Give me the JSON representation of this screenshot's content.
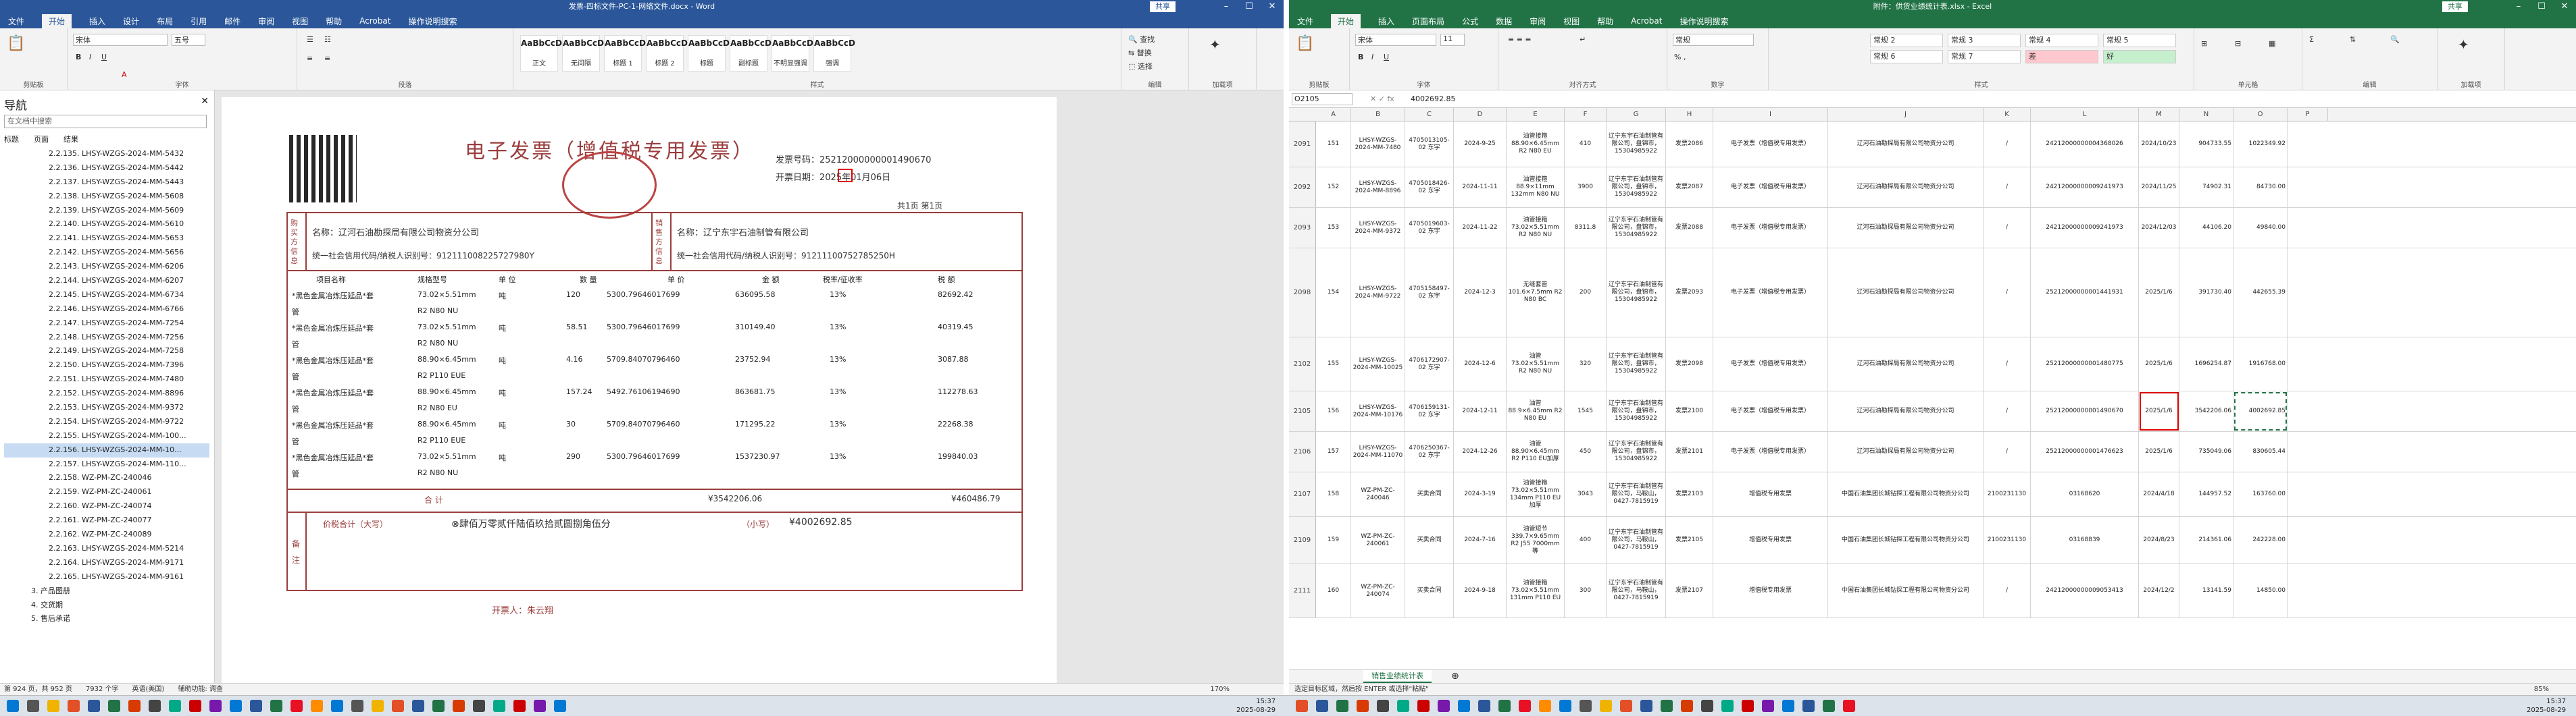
{
  "word": {
    "title": "发票-四标文件-PC-1-网络文件.docx - Word",
    "share_label": "共享",
    "menu": [
      "文件",
      "开始",
      "插入",
      "设计",
      "布局",
      "引用",
      "邮件",
      "审阅",
      "视图",
      "帮助",
      "Acrobat",
      "操作说明搜索"
    ],
    "active_menu": "开始",
    "font_name": "宋体",
    "font_size": "五号",
    "styles": [
      "正文",
      "无间隔",
      "标题 1",
      "标题 2",
      "标题",
      "副标题",
      "不明显强调",
      "强调"
    ],
    "ribbon_groups": [
      "剪贴板",
      "字体",
      "段落",
      "样式",
      "编辑",
      "加载项"
    ],
    "nav": {
      "header": "导航",
      "search_placeholder": "在文档中搜索",
      "tabs": [
        "标题",
        "页面",
        "结果"
      ],
      "items": [
        "2.2.135. LHSY-WZGS-2024-MM-5432",
        "2.2.136. LHSY-WZGS-2024-MM-5442",
        "2.2.137. LHSY-WZGS-2024-MM-5443",
        "2.2.138. LHSY-WZGS-2024-MM-5608",
        "2.2.139. LHSY-WZGS-2024-MM-5609",
        "2.2.140. LHSY-WZGS-2024-MM-5610",
        "2.2.141. LHSY-WZGS-2024-MM-5653",
        "2.2.142. LHSY-WZGS-2024-MM-5656",
        "2.2.143. LHSY-WZGS-2024-MM-6206",
        "2.2.144. LHSY-WZGS-2024-MM-6207",
        "2.2.145. LHSY-WZGS-2024-MM-6734",
        "2.2.146. LHSY-WZGS-2024-MM-6766",
        "2.2.147. LHSY-WZGS-2024-MM-7254",
        "2.2.148. LHSY-WZGS-2024-MM-7256",
        "2.2.149. LHSY-WZGS-2024-MM-7258",
        "2.2.150. LHSY-WZGS-2024-MM-7396",
        "2.2.151. LHSY-WZGS-2024-MM-7480",
        "2.2.152. LHSY-WZGS-2024-MM-8896",
        "2.2.153. LHSY-WZGS-2024-MM-9372",
        "2.2.154. LHSY-WZGS-2024-MM-9722",
        "2.2.155. LHSY-WZGS-2024-MM-100...",
        "2.2.156. LHSY-WZGS-2024-MM-10...",
        "2.2.157. LHSY-WZGS-2024-MM-110...",
        "2.2.158. WZ-PM-ZC-240046",
        "2.2.159. WZ-PM-ZC-240061",
        "2.2.160. WZ-PM-ZC-240074",
        "2.2.161. WZ-PM-ZC-240077",
        "2.2.162. WZ-PM-ZC-240089",
        "2.2.163. LHSY-WZGS-2024-MM-5214",
        "2.2.164. LHSY-WZGS-2024-MM-9171",
        "2.2.165. LHSY-WZGS-2024-MM-9161",
        "3. 产品图册",
        "4. 交货期",
        "5. 售后承诺"
      ],
      "selected_index": 21
    },
    "invoice": {
      "title": "电子发票（增值税专用发票）",
      "invoice_no_label": "发票号码：",
      "invoice_no": "25212000000001490670",
      "date_label": "开票日期：",
      "date": "2025年01月06日",
      "page": "共1页 第1页",
      "buyer_name": "名称：辽河石油勘探局有限公司物资分公司",
      "buyer_tax": "统一社会信用代码/纳税人识别号：912111008225727980Y",
      "seller_name": "名称：辽宁东宇石油制管有限公司",
      "seller_tax": "统一社会信用代码/纳税人识别号：91211100752785250H",
      "buyer_side": "购买方信息",
      "seller_side": "销售方信息",
      "col_headers": [
        "项目名称",
        "规格型号",
        "单 位",
        "数 量",
        "单 价",
        "金 额",
        "税率/征收率",
        "税 额"
      ],
      "items": [
        {
          "name": "*黑色金属冶炼压延品*套",
          "spec": "73.02×5.51mm",
          "unit": "吨",
          "qty": "120",
          "price": "5300.79646017699",
          "amount": "636095.58",
          "rate": "13%",
          "tax": "82692.42"
        },
        {
          "name": "管",
          "spec": "R2 N80 NU",
          "unit": "",
          "qty": "",
          "price": "",
          "amount": "",
          "rate": "",
          "tax": ""
        },
        {
          "name": "*黑色金属冶炼压延品*套",
          "spec": "73.02×5.51mm",
          "unit": "吨",
          "qty": "58.51",
          "price": "5300.79646017699",
          "amount": "310149.40",
          "rate": "13%",
          "tax": "40319.45"
        },
        {
          "name": "管",
          "spec": "R2 N80 NU",
          "unit": "",
          "qty": "",
          "price": "",
          "amount": "",
          "rate": "",
          "tax": ""
        },
        {
          "name": "*黑色金属冶炼压延品*套",
          "spec": "88.90×6.45mm",
          "unit": "吨",
          "qty": "4.16",
          "price": "5709.84070796460",
          "amount": "23752.94",
          "rate": "13%",
          "tax": "3087.88"
        },
        {
          "name": "管",
          "spec": "R2 P110 EUE",
          "unit": "",
          "qty": "",
          "price": "",
          "amount": "",
          "rate": "",
          "tax": ""
        },
        {
          "name": "*黑色金属冶炼压延品*套",
          "spec": "88.90×6.45mm",
          "unit": "吨",
          "qty": "157.24",
          "price": "5492.76106194690",
          "amount": "863681.75",
          "rate": "13%",
          "tax": "112278.63"
        },
        {
          "name": "管",
          "spec": "R2 N80 EU",
          "unit": "",
          "qty": "",
          "price": "",
          "amount": "",
          "rate": "",
          "tax": ""
        },
        {
          "name": "*黑色金属冶炼压延品*套",
          "spec": "88.90×6.45mm",
          "unit": "吨",
          "qty": "30",
          "price": "5709.84070796460",
          "amount": "171295.22",
          "rate": "13%",
          "tax": "22268.38"
        },
        {
          "name": "管",
          "spec": "R2 P110 EUE",
          "unit": "",
          "qty": "",
          "price": "",
          "amount": "",
          "rate": "",
          "tax": ""
        },
        {
          "name": "*黑色金属冶炼压延品*套",
          "spec": "73.02×5.51mm",
          "unit": "吨",
          "qty": "290",
          "price": "5300.79646017699",
          "amount": "1537230.97",
          "rate": "13%",
          "tax": "199840.03"
        },
        {
          "name": "管",
          "spec": "R2 N80 NU",
          "unit": "",
          "qty": "",
          "price": "",
          "amount": "",
          "rate": "",
          "tax": ""
        }
      ],
      "total_label": "合 计",
      "total_amount": "¥3542206.06",
      "total_tax": "¥460486.79",
      "grand_label": "价税合计（大写）",
      "grand_cn": "⊗肆佰万零贰仟陆佰玖拾贰圆捌角伍分",
      "grand_small_label": "（小写）",
      "grand_small": "¥4002692.85",
      "remark_label": "备 注",
      "issuer": "开票人：朱云翔"
    },
    "status": [
      "第 924 页，共 952 页",
      "7932 个字",
      "英语(美国)",
      "辅助功能: 调查"
    ],
    "zoom": "170%"
  },
  "excel": {
    "title": "附件：供货业绩统计表.xlsx - Excel",
    "share_label": "共享",
    "menu": [
      "文件",
      "开始",
      "插入",
      "页面布局",
      "公式",
      "数据",
      "审阅",
      "视图",
      "帮助",
      "Acrobat",
      "操作说明搜索"
    ],
    "active_menu": "开始",
    "font_name": "宋体",
    "font_size": "11",
    "number_format": "常规",
    "cell_styles": [
      "常规 2",
      "常规 3",
      "常规 4",
      "常规 5",
      "常规 6",
      "常规 7",
      "差",
      "好"
    ],
    "ribbon_groups": [
      "剪贴板",
      "字体",
      "对齐方式",
      "数字",
      "样式",
      "单元格",
      "编辑",
      "加载项"
    ],
    "name_box": "O2105",
    "formula": "4002692.85",
    "columns": [
      "A",
      "B",
      "C",
      "D",
      "E",
      "F",
      "G",
      "H",
      "I",
      "J",
      "K",
      "L",
      "M",
      "N",
      "O",
      "P"
    ],
    "rows": [
      {
        "rn": "2091",
        "no": "151",
        "proj": "LHSY-WZGS-2024-MM-7480",
        "code": "4705013105-02 东宇",
        "date": "2024-9-25",
        "spec": "油管接箍 88.90×6.45mm R2 N80 EU",
        "qty": "410",
        "seller": "辽宁东宇石油制管有限公司，盘锦市，15304985922",
        "inv": "发票2086",
        "type": "电子发票（增值税专用发票）",
        "buyer": "辽河石油勘探局有限公司物资分公司",
        "slash": "/",
        "invno": "24212000000004368026",
        "invdate": "2024/10/23",
        "amt": "904733.55",
        "total": "1022349.92"
      },
      {
        "rn": "2092",
        "no": "152",
        "proj": "LHSY-WZGS-2024-MM-8896",
        "code": "4705018426-02 东宇",
        "date": "2024-11-11",
        "spec": "油管接箍 88.9×11mm 132mm N80 NU",
        "qty": "3900",
        "seller": "辽宁东宇石油制管有限公司，盘锦市，15304985922",
        "inv": "发票2087",
        "type": "电子发票（增值税专用发票）",
        "buyer": "辽河石油勘探局有限公司物资分公司",
        "slash": "/",
        "invno": "24212000000009241973",
        "invdate": "2024/11/25",
        "amt": "74902.31",
        "total": "84730.00"
      },
      {
        "rn": "2093",
        "no": "153",
        "proj": "LHSY-WZGS-2024-MM-9372",
        "code": "4705019603-02 东宇",
        "date": "2024-11-22",
        "spec": "油管接箍 73.02×5.51mm R2 N80 NU",
        "qty": "8311.8",
        "seller": "辽宁东宇石油制管有限公司，盘锦市，15304985922",
        "inv": "发票2088",
        "type": "电子发票（增值税专用发票）",
        "buyer": "辽河石油勘探局有限公司物资分公司",
        "slash": "/",
        "invno": "24212000000009241973",
        "invdate": "2024/12/03",
        "amt": "44106.20",
        "total": "49840.00"
      },
      {
        "rn": "2098",
        "no": "154",
        "proj": "LHSY-WZGS-2024-MM-9722",
        "code": "4705158497-02 东宇",
        "date": "2024-12-3",
        "spec": "无缝套管 101.6×7.5mm R2 N80 BC",
        "qty": "200",
        "seller": "辽宁东宇石油制管有限公司，盘锦市，15304985922",
        "inv": "发票2093",
        "type": "电子发票（增值税专用发票）",
        "buyer": "辽河石油勘探局有限公司物资分公司",
        "slash": "/",
        "invno": "25212000000001441931",
        "invdate": "2025/1/6",
        "amt": "391730.40",
        "total": "442655.39"
      },
      {
        "rn": "2102",
        "no": "155",
        "proj": "LHSY-WZGS-2024-MM-10025",
        "code": "4706172907-02 东宇",
        "date": "2024-12-6",
        "spec": "油管 73.02×5.51mm R2 N80 NU",
        "qty": "320",
        "seller": "辽宁东宇石油制管有限公司，盘锦市，15304985922",
        "inv": "发票2098",
        "type": "电子发票（增值税专用发票）",
        "buyer": "辽河石油勘探局有限公司物资分公司",
        "slash": "/",
        "invno": "25212000000001480775",
        "invdate": "2025/1/6",
        "amt": "1696254.87",
        "total": "1916768.00"
      },
      {
        "rn": "2105",
        "no": "156",
        "proj": "LHSY-WZGS-2024-MM-10176",
        "code": "4706159131-02 东宇",
        "date": "2024-12-11",
        "spec": "油管 88.9×6.45mm R2 N80 EU",
        "qty": "1545",
        "seller": "辽宁东宇石油制管有限公司，盘锦市，15304985922",
        "inv": "发票2100",
        "type": "电子发票（增值税专用发票）",
        "buyer": "辽河石油勘探局有限公司物资分公司",
        "slash": "/",
        "invno": "25212000000001490670",
        "invdate": "2025/1/6",
        "amt": "3542206.06",
        "total": "4002692.85"
      },
      {
        "rn": "2106",
        "no": "157",
        "proj": "LHSY-WZGS-2024-MM-11070",
        "code": "4706250367-02 东宇",
        "date": "2024-12-26",
        "spec": "油管 88.90×6.45mm R2 P110 EU加厚",
        "qty": "450",
        "seller": "辽宁东宇石油制管有限公司，盘锦市，15304985922",
        "inv": "发票2101",
        "type": "电子发票（增值税专用发票）",
        "buyer": "辽河石油勘探局有限公司物资分公司",
        "slash": "/",
        "invno": "25212000000001476623",
        "invdate": "2025/1/6",
        "amt": "735049.06",
        "total": "830605.44"
      },
      {
        "rn": "2107",
        "no": "158",
        "proj": "WZ-PM-ZC-240046",
        "code": "买卖合同",
        "date": "2024-3-19",
        "spec": "油管接箍 73.02×5.51mm 134mm P110 EU加厚",
        "qty": "3043",
        "seller": "辽宁东宇石油制管有限公司，马鞍山，0427-7815919",
        "inv": "发票2103",
        "type": "增值税专用发票",
        "buyer": "中国石油集团长城钻探工程有限公司物资分公司",
        "slash": "2100231130",
        "invno": "03168620",
        "invdate": "2024/4/18",
        "amt": "144957.52",
        "total": "163760.00"
      },
      {
        "rn": "2109",
        "no": "159",
        "proj": "WZ-PM-ZC-240061",
        "code": "买卖合同",
        "date": "2024-7-16",
        "spec": "油管短节 339.7×9.65mm R2 J55 7000mm等",
        "qty": "400",
        "seller": "辽宁东宇石油制管有限公司，马鞍山，0427-7815919",
        "inv": "发票2105",
        "type": "增值税专用发票",
        "buyer": "中国石油集团长城钻探工程有限公司物资分公司",
        "slash": "2100231130",
        "invno": "03168839",
        "invdate": "2024/8/23",
        "amt": "214361.06",
        "total": "242228.00"
      },
      {
        "rn": "2111",
        "no": "160",
        "proj": "WZ-PM-ZC-240074",
        "code": "买卖合同",
        "date": "2024-9-18",
        "spec": "油管接箍 73.02×5.51mm 131mm P110 EU",
        "qty": "300",
        "seller": "辽宁东宇石油制管有限公司，马鞍山，0427-7815919",
        "inv": "发票2107",
        "type": "增值税专用发票",
        "buyer": "中国石油集团长城钻探工程有限公司物资分公司",
        "slash": "/",
        "invno": "24212000000009053413",
        "invdate": "2024/12/2",
        "amt": "13141.59",
        "total": "14850.00"
      }
    ],
    "sheet_tab": "销售业绩统计表",
    "status": "选定目标区域，然后按 ENTER 或选择\"粘贴\"",
    "zoom": "85%"
  },
  "taskbar": {
    "time_left": "15:37",
    "date_left": "2025-08-29",
    "time_right": "15:37",
    "date_right": "2025-08-29"
  }
}
